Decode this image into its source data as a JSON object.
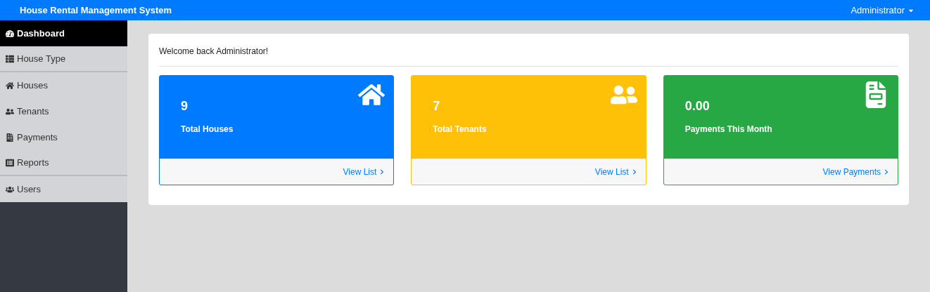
{
  "topbar": {
    "title": "House Rental Management System",
    "user": "Administrator"
  },
  "sidebar": {
    "items": [
      {
        "label": "Dashboard",
        "selected": true
      },
      {
        "label": "House Type",
        "selected": false
      },
      {
        "label": "Houses",
        "selected": false
      },
      {
        "label": "Tenants",
        "selected": false
      },
      {
        "label": "Payments",
        "selected": false
      },
      {
        "label": "Reports",
        "selected": false
      },
      {
        "label": "Users",
        "selected": false
      }
    ]
  },
  "welcome": "Welcome back Administrator!",
  "cards": [
    {
      "value": "9",
      "label": "Total Houses",
      "link": "View List",
      "color": "#007bff"
    },
    {
      "value": "7",
      "label": "Total Tenants",
      "link": "View List",
      "color": "#ffc107"
    },
    {
      "value": "0.00",
      "label": "Payments This Month",
      "link": "View Payments",
      "color": "#28a745"
    }
  ]
}
